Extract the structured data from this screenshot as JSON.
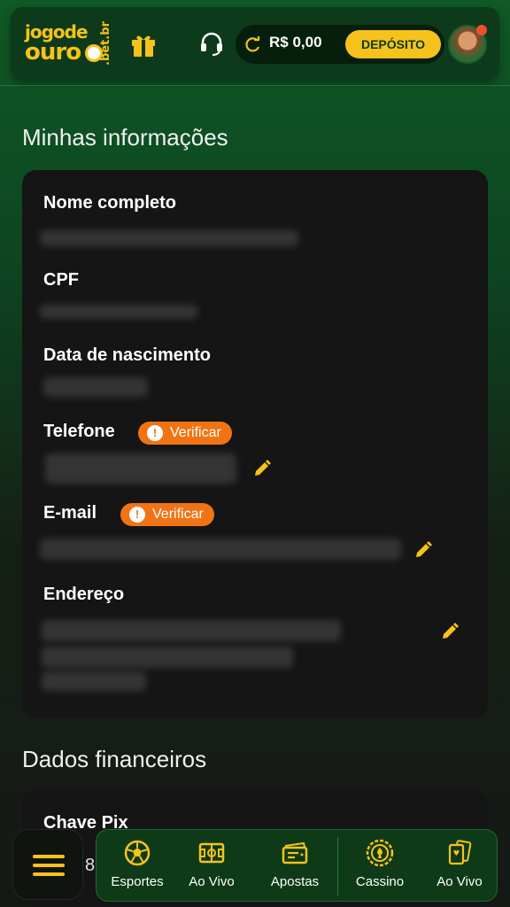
{
  "header": {
    "logo_line1": "jogode",
    "logo_line2": "ouro",
    "logo_suffix": ".bet.br",
    "balance": "R$ 0,00",
    "deposit_label": "DEPÓSITO"
  },
  "personal": {
    "title": "Minhas informações",
    "fields": [
      {
        "label": "Nome completo"
      },
      {
        "label": "CPF"
      },
      {
        "label": "Data de nascimento"
      },
      {
        "label": "Telefone",
        "badge": "Verificar"
      },
      {
        "label": "E-mail",
        "badge": "Verificar"
      },
      {
        "label": "Endereço"
      }
    ]
  },
  "financial": {
    "title": "Dados financeiros",
    "first_label": "Chave Pix",
    "partial_value": "8"
  },
  "bottom_nav": {
    "items": [
      {
        "label": "Esportes",
        "icon": "soccer-ball-icon"
      },
      {
        "label": "Ao Vivo",
        "icon": "live-field-icon"
      },
      {
        "label": "Apostas",
        "icon": "bet-ticket-icon"
      },
      {
        "label": "Cassino",
        "icon": "casino-chip-icon"
      },
      {
        "label": "Ao Vivo",
        "icon": "playing-cards-icon"
      }
    ]
  },
  "colors": {
    "accent": "#f6c21b",
    "badge": "#f07414",
    "card": "#151515",
    "header": "#0d3a1a"
  }
}
